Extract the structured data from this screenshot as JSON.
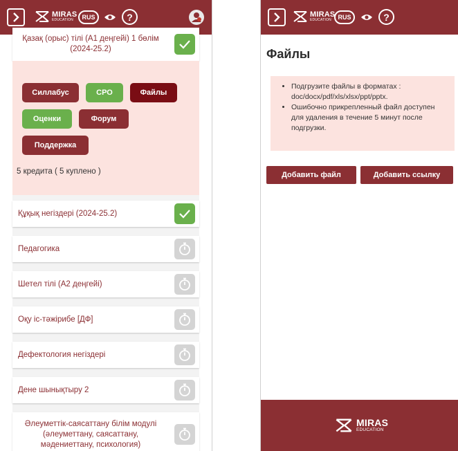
{
  "header": {
    "logo_name": "MIRAS",
    "logo_sub": "EDUCATION",
    "language": "RUS"
  },
  "left": {
    "top_card_title": "Қазақ (орыс) тілі (А1 деңгейі) 1 бөлім (2024-25.2)",
    "buttons": {
      "syllabus": "Силлабус",
      "srs": "СРО",
      "files": "Файлы",
      "grades": "Оценки",
      "forum": "Форум",
      "support": "Поддержка"
    },
    "credits": "5 кредита ( 5 куплено )",
    "courses": [
      {
        "title": "Құқық негіздері (2024-25.2)",
        "status": "done"
      },
      {
        "title": "Педагогика",
        "status": "pending"
      },
      {
        "title": "Шетел тілі (А2 деңгейі)",
        "status": "pending"
      },
      {
        "title": "Оқу іс-тәжірибе [ДФ]",
        "status": "pending"
      },
      {
        "title": "Дефектология негіздері",
        "status": "pending"
      },
      {
        "title": "Дене шынықтыру 2",
        "status": "pending"
      },
      {
        "title": "Әлеуметтік-саясаттану білім модулі (әлеуметтану, саясаттану, мәдениеттану, психология)",
        "status": "pending"
      }
    ]
  },
  "right": {
    "title": "Файлы",
    "info": [
      "Подгрузите файлы в форматах : doc/docx/pdf/xls/xlsx/ppt/pptx.",
      "Ошибочно прикрепленный файл доступен для удаления в течение 5 минут после подгрузки."
    ],
    "add_file": "Добавить файл",
    "add_link": "Добавить ссылку"
  },
  "colors": {
    "brand": "#8b2f33",
    "green": "#6ab04c",
    "pink": "#fce3df",
    "gray": "#d4d4d4"
  },
  "icons": [
    "chevron-right-icon",
    "miras-logo",
    "eye-icon",
    "help-icon",
    "avatar",
    "check-icon",
    "stopwatch-icon"
  ]
}
